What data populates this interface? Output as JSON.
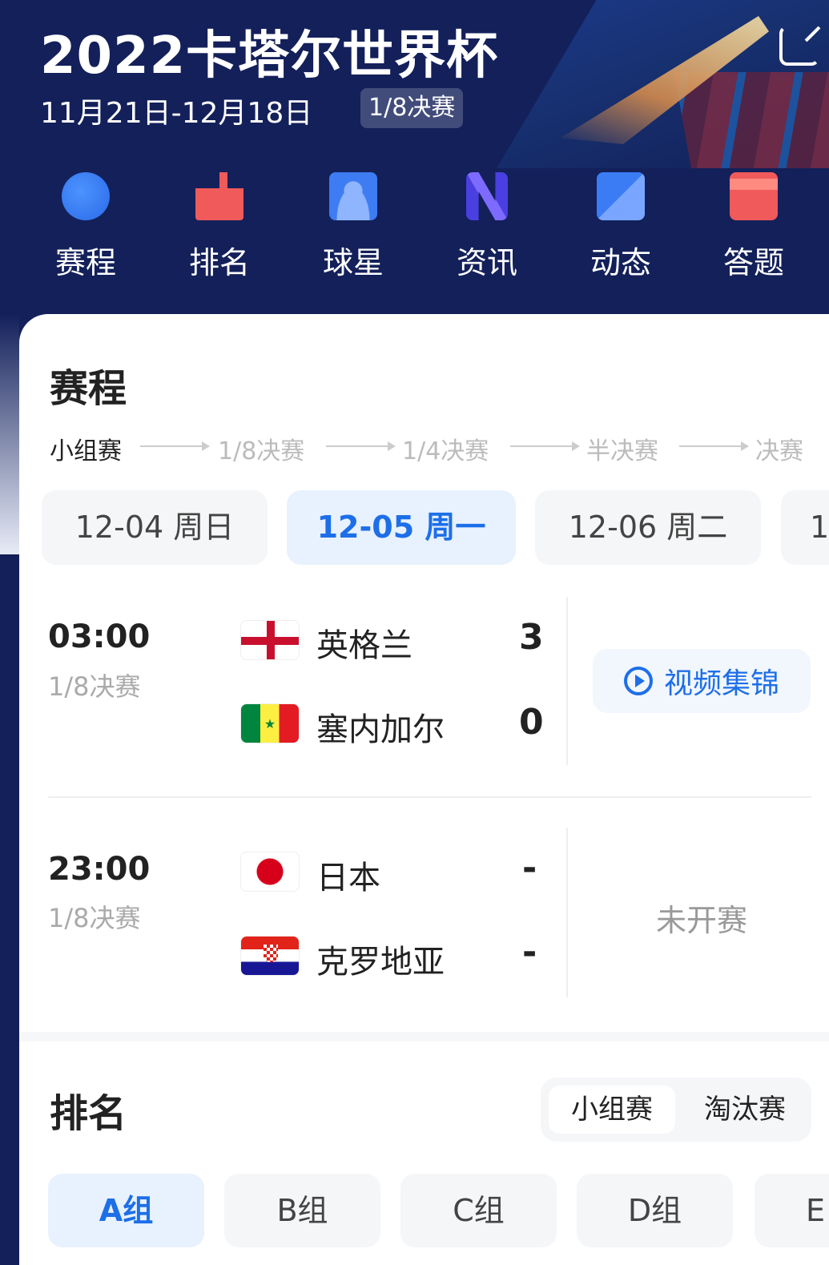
{
  "header": {
    "title": "2022卡塔尔世界杯",
    "dates": "11月21日-12月18日",
    "stage_badge": "1/8决赛",
    "share_icon": "share-icon"
  },
  "nav": [
    {
      "label": "赛程",
      "icon": "clock-icon",
      "color": "#3b82f6"
    },
    {
      "label": "排名",
      "icon": "podium-icon",
      "color": "#f05a5a"
    },
    {
      "label": "球星",
      "icon": "player-card-icon",
      "color": "#4a86f5"
    },
    {
      "label": "资讯",
      "icon": "news-n-icon",
      "color": "#6a5af5"
    },
    {
      "label": "动态",
      "icon": "image-icon",
      "color": "#4a86f5"
    },
    {
      "label": "答题",
      "icon": "gift-icon",
      "color": "#f05a5a"
    }
  ],
  "schedule": {
    "title": "赛程",
    "stages": [
      "小组赛",
      "1/8决赛",
      "1/4决赛",
      "半决赛",
      "决赛"
    ],
    "dates": [
      "12-04 周日",
      "12-05 周一",
      "12-06 周二",
      "1"
    ],
    "selected_date": "12-05 周一",
    "matches": [
      {
        "time": "03:00",
        "stage": "1/8决赛",
        "home": "英格兰",
        "home_score": "3",
        "away": "塞内加尔",
        "away_score": "0",
        "action": "视频集锦"
      },
      {
        "time": "23:00",
        "stage": "1/8决赛",
        "home": "日本",
        "home_score": "-",
        "away": "克罗地亚",
        "away_score": "-",
        "status": "未开赛"
      }
    ]
  },
  "ranking": {
    "title": "排名",
    "toggle": [
      "小组赛",
      "淘汰赛"
    ],
    "groups": [
      "A组",
      "B组",
      "C组",
      "D组",
      "E"
    ],
    "selected_group": "A组"
  },
  "colors": {
    "background": "#13205a",
    "accent": "#1d6fe8"
  }
}
